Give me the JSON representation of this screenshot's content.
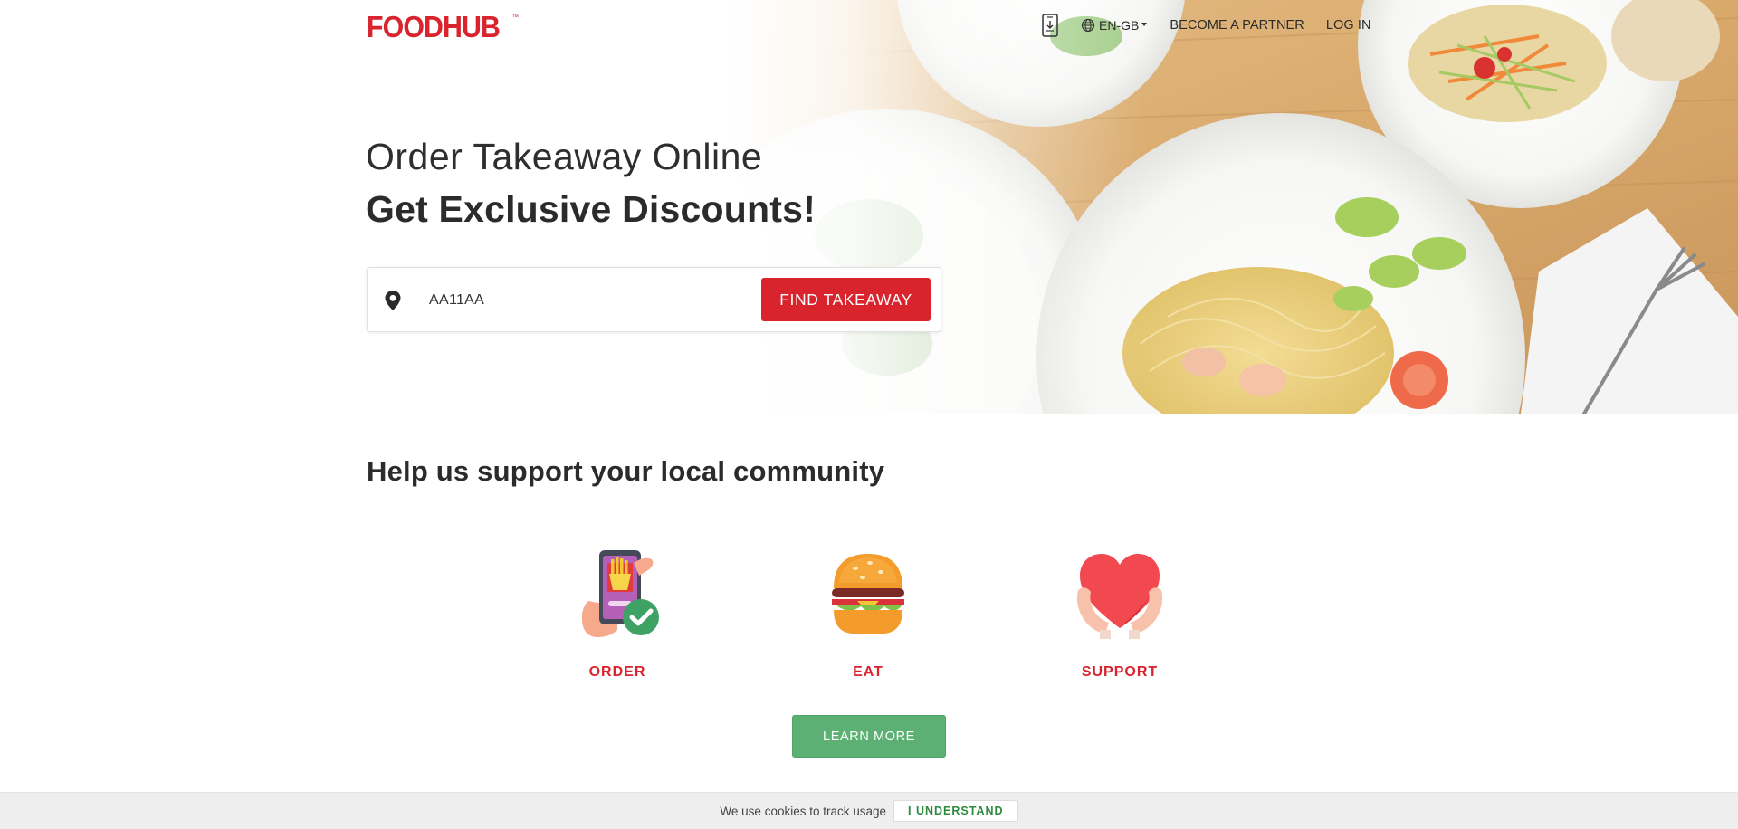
{
  "header": {
    "logo_text": "FOODHUB",
    "logo_tm": "™",
    "language": "EN-GB",
    "become_partner": "BECOME A PARTNER",
    "login": "LOG IN"
  },
  "hero": {
    "title": "Order Takeaway Online",
    "subtitle": "Get Exclusive Discounts!",
    "search": {
      "value": "AA11AA",
      "button_label": "FIND TAKEAWAY"
    }
  },
  "community": {
    "title": "Help us support your local community",
    "features": [
      {
        "label": "ORDER",
        "icon": "phone-order-icon"
      },
      {
        "label": "EAT",
        "icon": "burger-icon"
      },
      {
        "label": "SUPPORT",
        "icon": "heart-hands-icon"
      }
    ],
    "learn_more": "LEARN MORE"
  },
  "cookie": {
    "text": "We use cookies to track usage",
    "button": "I UNDERSTAND"
  },
  "colors": {
    "brand_red": "#d9232d",
    "learn_green": "#5cb074",
    "cookie_green": "#2e8b3e",
    "cookie_bg": "#eeeeee"
  }
}
